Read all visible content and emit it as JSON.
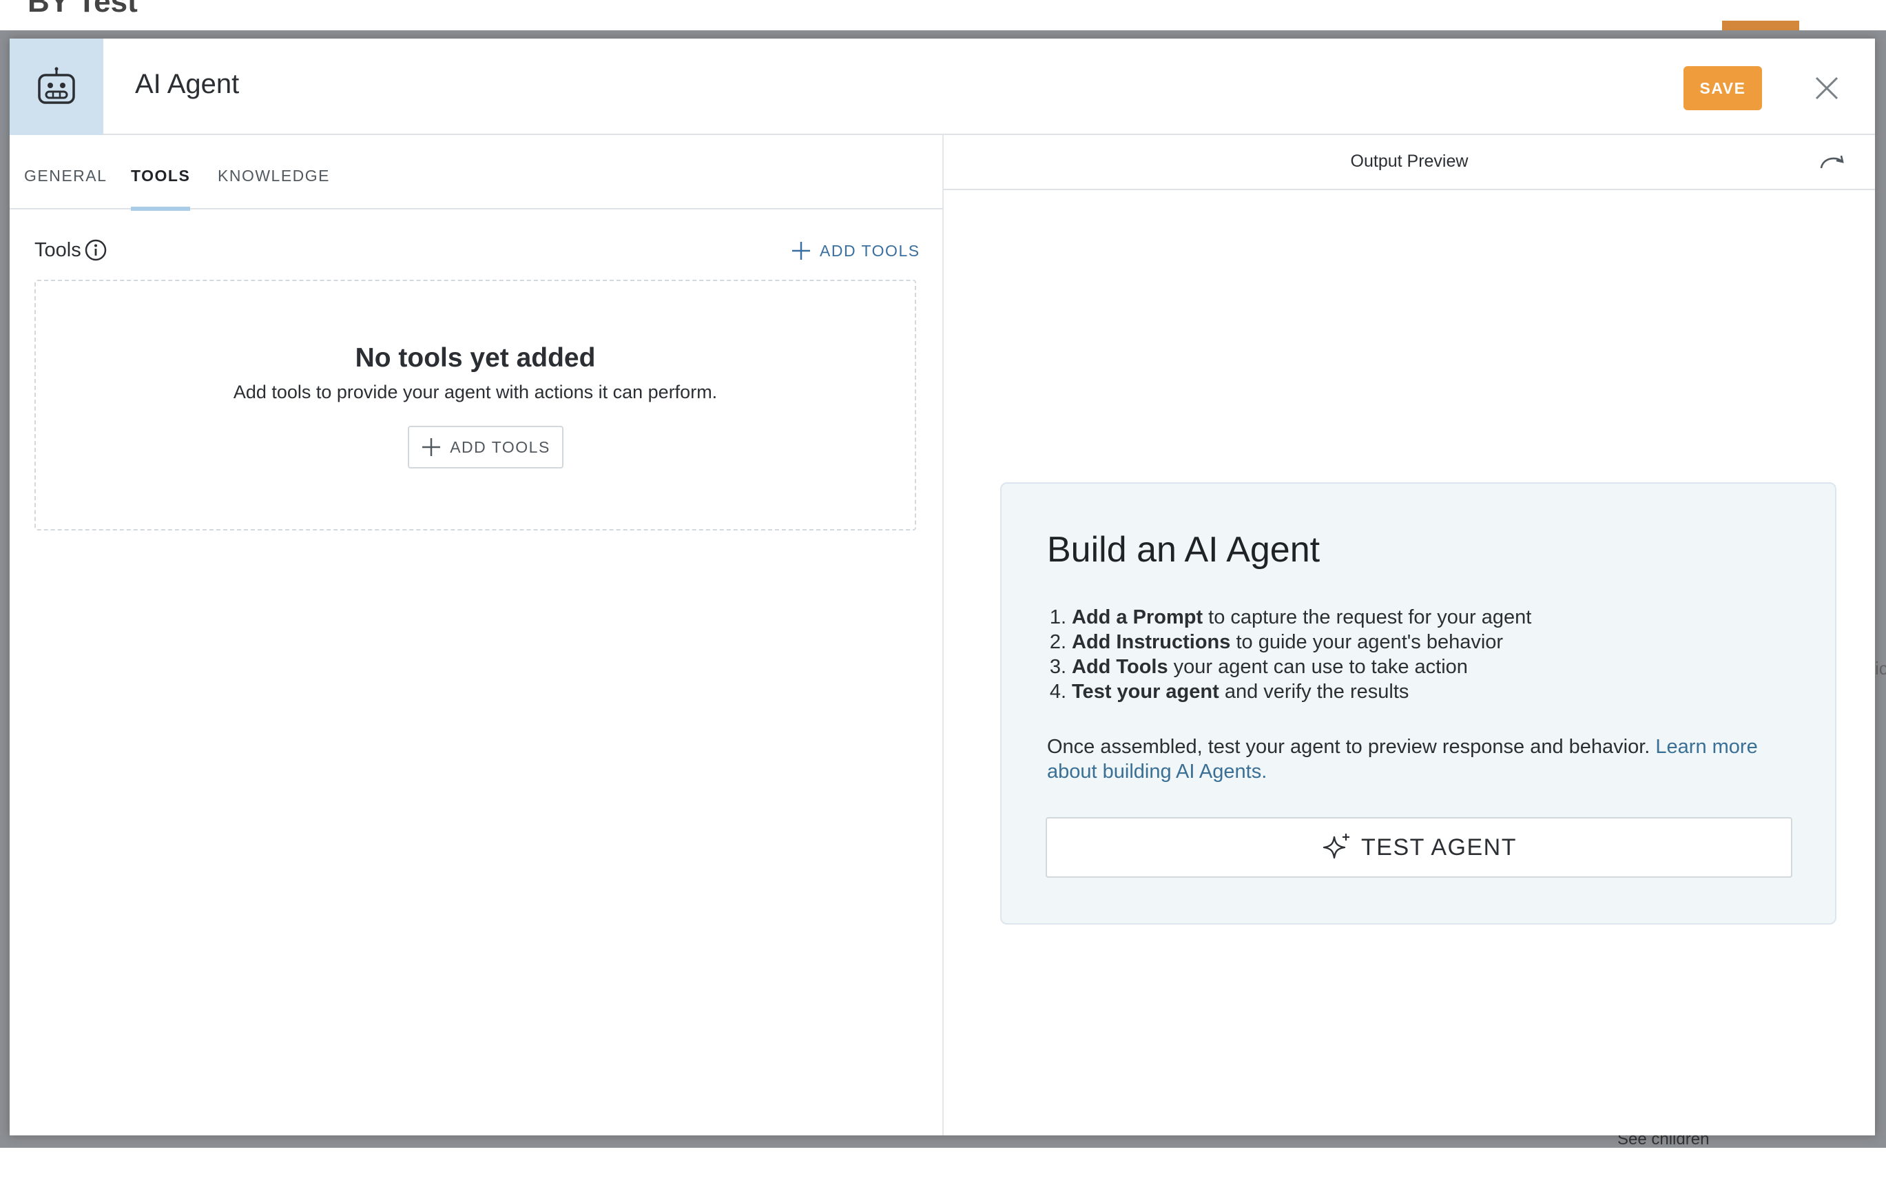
{
  "background": {
    "title_fragment": "BY Test",
    "side_text_fragment": "ic",
    "see_children": "See children"
  },
  "header": {
    "title": "AI Agent",
    "icon": "robot-icon",
    "save_label": "SAVE",
    "close_icon": "close-icon"
  },
  "tabs": [
    {
      "label": "GENERAL",
      "active": false
    },
    {
      "label": "TOOLS",
      "active": true
    },
    {
      "label": "KNOWLEDGE",
      "active": false
    }
  ],
  "tools": {
    "label": "Tools",
    "info_icon": "info-icon",
    "add_tools_label": "ADD TOOLS",
    "empty_title": "No tools yet added",
    "empty_subtitle": "Add tools to provide your agent with actions it can perform.",
    "empty_add_label": "ADD TOOLS"
  },
  "preview": {
    "title": "Output Preview",
    "refresh_icon": "redo-icon",
    "card": {
      "title": "Build an AI Agent",
      "steps": [
        {
          "num": "1.",
          "bold": "Add a Prompt",
          "rest": " to capture the request for your agent"
        },
        {
          "num": "2.",
          "bold": "Add Instructions",
          "rest": " to guide your agent's behavior"
        },
        {
          "num": "3.",
          "bold": "Add Tools",
          "rest": " your agent can use to take action"
        },
        {
          "num": "4.",
          "bold": "Test your agent",
          "rest": " and verify the results"
        }
      ],
      "description": "Once assembled, test your agent to preview response and behavior. ",
      "learn_more": "Learn more about building AI Agents.",
      "test_label": "TEST AGENT",
      "test_icon": "sparkle-icon"
    }
  },
  "colors": {
    "save": "#ee9c3c",
    "header_icon_bg": "#cfe0ef",
    "tab_indicator": "#a9cce8",
    "link": "#3a6fa0",
    "card_bg": "#f1f6f9"
  }
}
